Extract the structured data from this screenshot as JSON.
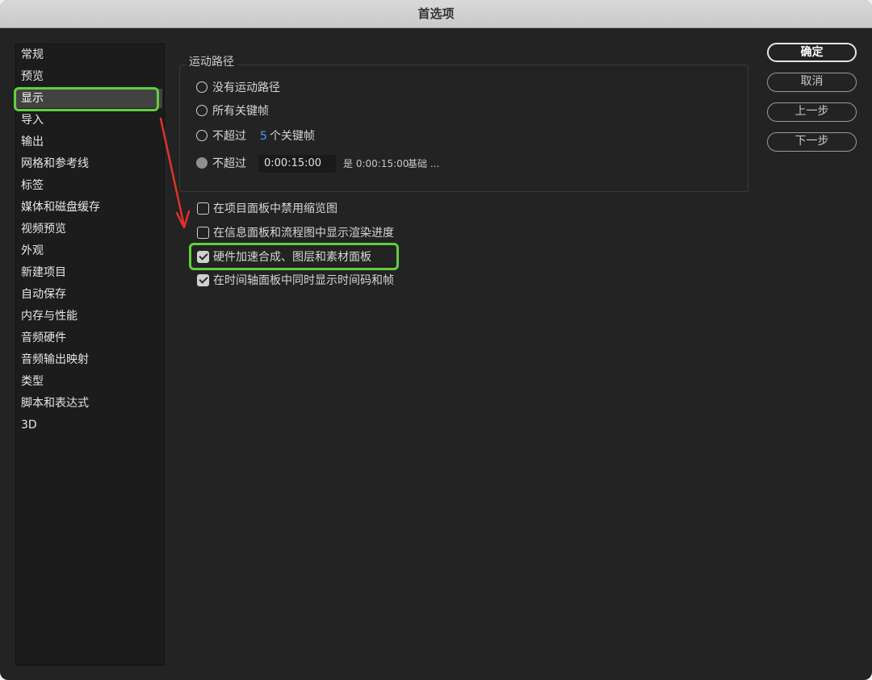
{
  "window": {
    "title": "首选项"
  },
  "sidebar": {
    "selected_index": 2,
    "items": [
      {
        "label": "常规"
      },
      {
        "label": "预览"
      },
      {
        "label": "显示"
      },
      {
        "label": "导入"
      },
      {
        "label": "输出"
      },
      {
        "label": "网格和参考线"
      },
      {
        "label": "标签"
      },
      {
        "label": "媒体和磁盘缓存"
      },
      {
        "label": "视频预览"
      },
      {
        "label": "外观"
      },
      {
        "label": "新建项目"
      },
      {
        "label": "自动保存"
      },
      {
        "label": "内存与性能"
      },
      {
        "label": "音频硬件"
      },
      {
        "label": "音频输出映射"
      },
      {
        "label": "类型"
      },
      {
        "label": "脚本和表达式"
      },
      {
        "label": "3D"
      }
    ]
  },
  "motion_path": {
    "title": "运动路径",
    "options": [
      {
        "label": "没有运动路径",
        "selected": false
      },
      {
        "label": "所有关键帧",
        "selected": false
      },
      {
        "label": "不超过",
        "value": "5",
        "suffix": "个关键帧",
        "selected": false
      },
      {
        "label": "不超过",
        "timecode": "0:00:15:00",
        "note_prefix": "是 0:00:15:00",
        "note_suffix": "基础 ...",
        "selected": true
      }
    ]
  },
  "checkboxes": [
    {
      "label": "在项目面板中禁用缩览图",
      "checked": false
    },
    {
      "label": "在信息面板和流程图中显示渲染进度",
      "checked": false
    },
    {
      "label": "硬件加速合成、图层和素材面板",
      "checked": true
    },
    {
      "label": "在时间轴面板中同时显示时间码和帧",
      "checked": true
    }
  ],
  "buttons": {
    "ok": "确定",
    "cancel": "取消",
    "previous": "上一步",
    "next": "下一步"
  },
  "colors": {
    "highlight": "#5fcf3f",
    "arrow": "#e0322a",
    "value_blue": "#4d9bff"
  }
}
